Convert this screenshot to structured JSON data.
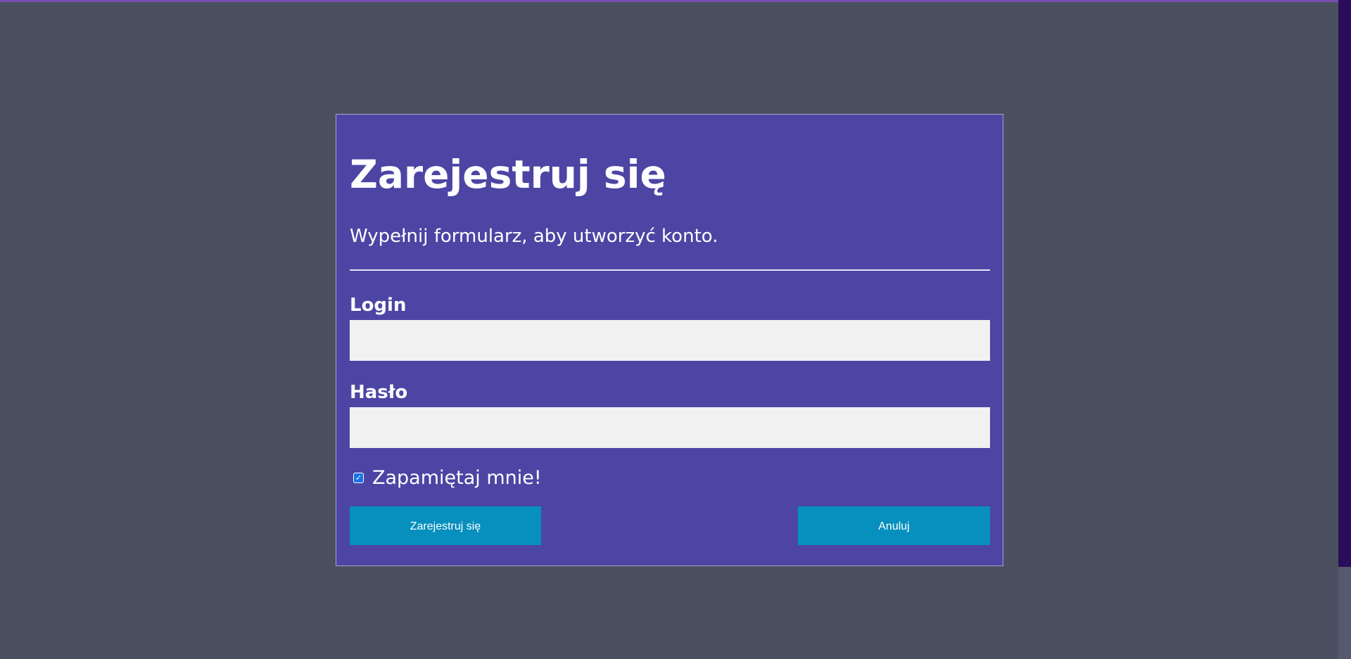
{
  "form": {
    "title": "Zarejestruj się",
    "subtitle": "Wypełnij formularz, aby utworzyć konto.",
    "login_label": "Login",
    "login_value": "",
    "password_label": "Hasło",
    "password_value": "",
    "remember_label": "Zapamiętaj mnie!",
    "remember_checked": true,
    "register_button": "Zarejestruj się",
    "cancel_button": "Anuluj"
  },
  "colors": {
    "page_background": "#4a5060",
    "modal_background": "#4c45a4",
    "button": "#078fbd",
    "input_background": "#f1f1f1"
  }
}
